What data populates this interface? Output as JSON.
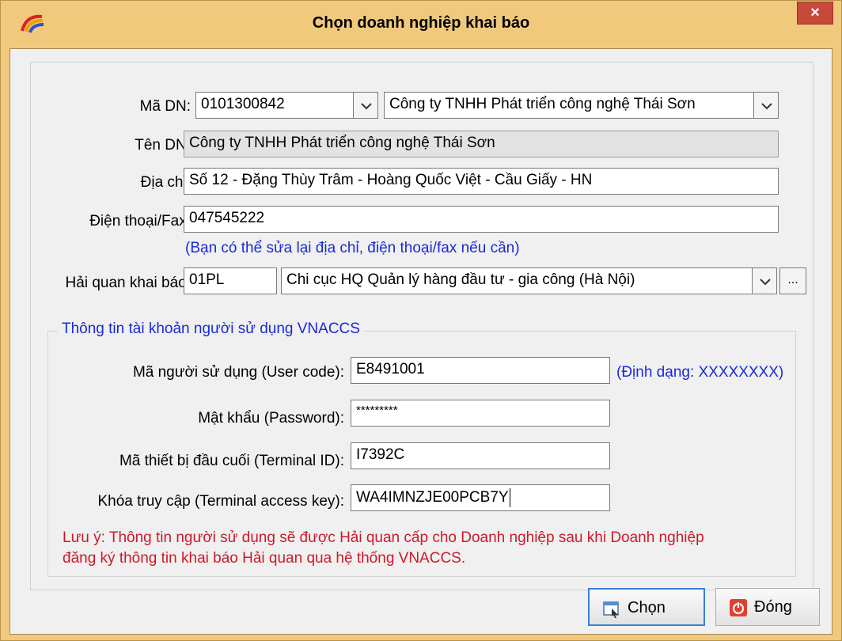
{
  "window": {
    "title": "Chọn doanh nghiệp khai báo",
    "close_glyph": "×"
  },
  "form": {
    "ma_dn": {
      "label": "Mã DN:",
      "value": "0101300842",
      "company_select": "Công ty TNHH Phát triển công nghệ Thái Sơn"
    },
    "ten_dn": {
      "label": "Tên DN:",
      "value": "Công ty TNHH Phát triển công nghệ Thái Sơn"
    },
    "dia_chi": {
      "label": "Địa chỉ:",
      "value": "Số 12 - Đặng Thùy Trâm - Hoàng Quốc Việt - Cầu Giấy - HN"
    },
    "dien_thoai": {
      "label": "Điện thoại/Fax:",
      "value": "047545222"
    },
    "edit_hint": "(Bạn có thể sửa lại địa chỉ, điện thoại/fax nếu cần)",
    "hai_quan": {
      "label": "Hải quan khai báo:",
      "code": "01PL",
      "name": "Chi cục HQ Quản lý hàng đầu tư - gia công (Hà Nội)",
      "browse_label": "..."
    }
  },
  "vnaccs": {
    "group_title": "Thông tin tài khoản người sử dụng VNACCS",
    "user_code": {
      "label": "Mã người sử dụng (User code):",
      "value": "E8491001",
      "format_hint": "(Định dạng: XXXXXXXX)"
    },
    "password": {
      "label": "Mật khẩu (Password):",
      "value": "*********"
    },
    "terminal_id": {
      "label": "Mã thiết bị đầu cuối (Terminal ID):",
      "value": "I7392C"
    },
    "access_key": {
      "label": "Khóa truy cập (Terminal access key):",
      "value": "WA4IMNZJE00PCB7Y"
    },
    "note_line1": "Lưu ý: Thông tin người sử dụng sẽ được Hải quan cấp cho Doanh nghiệp sau khi Doanh nghiệp",
    "note_line2": "đăng ký thông tin khai báo Hải quan qua hệ thống VNACCS."
  },
  "buttons": {
    "choose": "Chọn",
    "close": "Đóng"
  },
  "icons": {
    "app": "rainbow-arc-icon",
    "close": "close-icon",
    "dropdown": "chevron-down-icon",
    "choose": "choose-window-icon",
    "power": "power-icon"
  },
  "colors": {
    "title_bar": "#f0c97d",
    "close_button": "#c7493a",
    "hint_blue": "#1a2ad6",
    "note_red": "#cc1a2a",
    "primary_border": "#3c7fd6"
  }
}
